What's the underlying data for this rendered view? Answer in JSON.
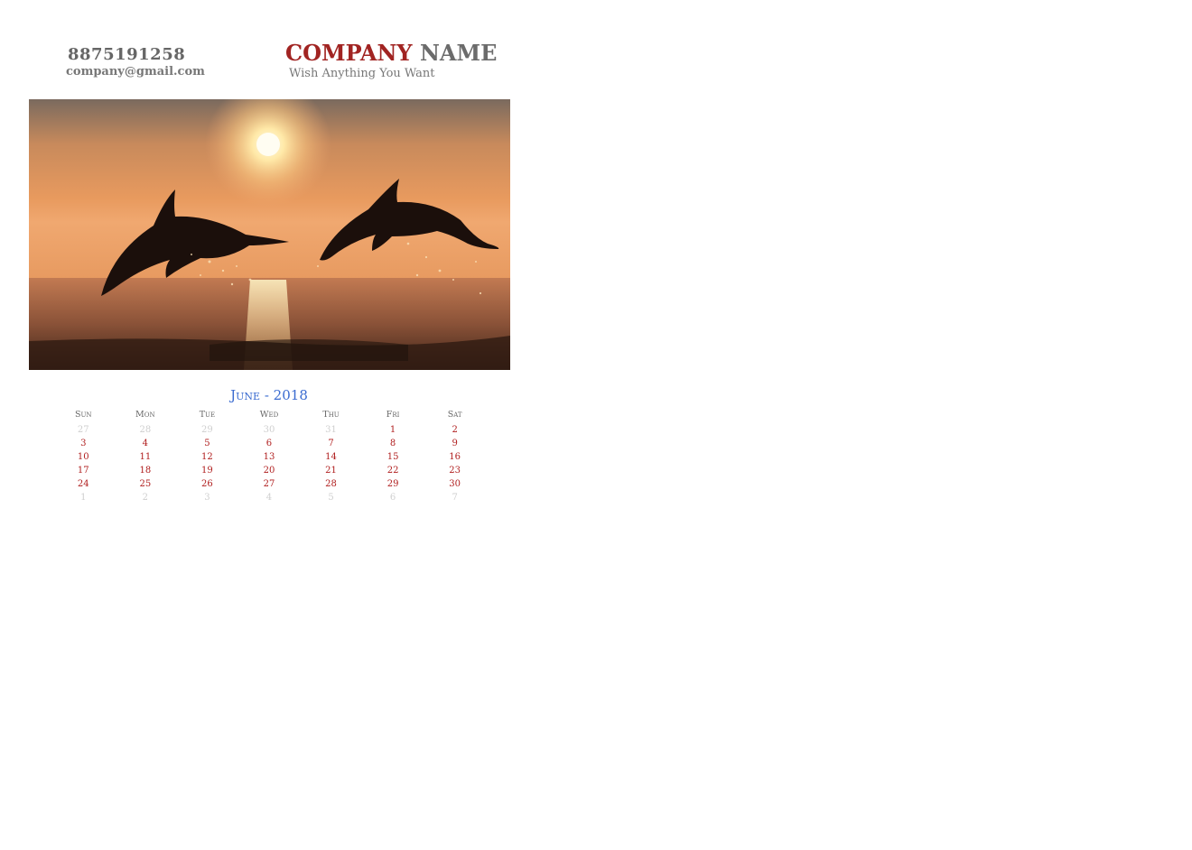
{
  "contact": {
    "phone": "8875191258",
    "email": "company@gmail.com"
  },
  "brand": {
    "company_word": "COMPANY",
    "name_word": "NAME",
    "tagline": "Wish Anything You Want"
  },
  "colors": {
    "accent_red": "#a12422",
    "month_blue": "#3a6bd0",
    "day_red": "#b01e1e",
    "muted_day": "#cfcfcf"
  },
  "calendar": {
    "title": "June - 2018",
    "weekdays": [
      "Sun",
      "Mon",
      "Tue",
      "Wed",
      "Thu",
      "Fri",
      "Sat"
    ],
    "weeks": [
      [
        {
          "d": "27",
          "in": false
        },
        {
          "d": "28",
          "in": false
        },
        {
          "d": "29",
          "in": false
        },
        {
          "d": "30",
          "in": false
        },
        {
          "d": "31",
          "in": false
        },
        {
          "d": "1",
          "in": true
        },
        {
          "d": "2",
          "in": true
        }
      ],
      [
        {
          "d": "3",
          "in": true
        },
        {
          "d": "4",
          "in": true
        },
        {
          "d": "5",
          "in": true
        },
        {
          "d": "6",
          "in": true
        },
        {
          "d": "7",
          "in": true
        },
        {
          "d": "8",
          "in": true
        },
        {
          "d": "9",
          "in": true
        }
      ],
      [
        {
          "d": "10",
          "in": true
        },
        {
          "d": "11",
          "in": true
        },
        {
          "d": "12",
          "in": true
        },
        {
          "d": "13",
          "in": true
        },
        {
          "d": "14",
          "in": true
        },
        {
          "d": "15",
          "in": true
        },
        {
          "d": "16",
          "in": true
        }
      ],
      [
        {
          "d": "17",
          "in": true
        },
        {
          "d": "18",
          "in": true
        },
        {
          "d": "19",
          "in": true
        },
        {
          "d": "20",
          "in": true
        },
        {
          "d": "21",
          "in": true
        },
        {
          "d": "22",
          "in": true
        },
        {
          "d": "23",
          "in": true
        }
      ],
      [
        {
          "d": "24",
          "in": true
        },
        {
          "d": "25",
          "in": true
        },
        {
          "d": "26",
          "in": true
        },
        {
          "d": "27",
          "in": true
        },
        {
          "d": "28",
          "in": true
        },
        {
          "d": "29",
          "in": true
        },
        {
          "d": "30",
          "in": true
        }
      ],
      [
        {
          "d": "1",
          "in": false
        },
        {
          "d": "2",
          "in": false
        },
        {
          "d": "3",
          "in": false
        },
        {
          "d": "4",
          "in": false
        },
        {
          "d": "5",
          "in": false
        },
        {
          "d": "6",
          "in": false
        },
        {
          "d": "7",
          "in": false
        }
      ]
    ]
  }
}
